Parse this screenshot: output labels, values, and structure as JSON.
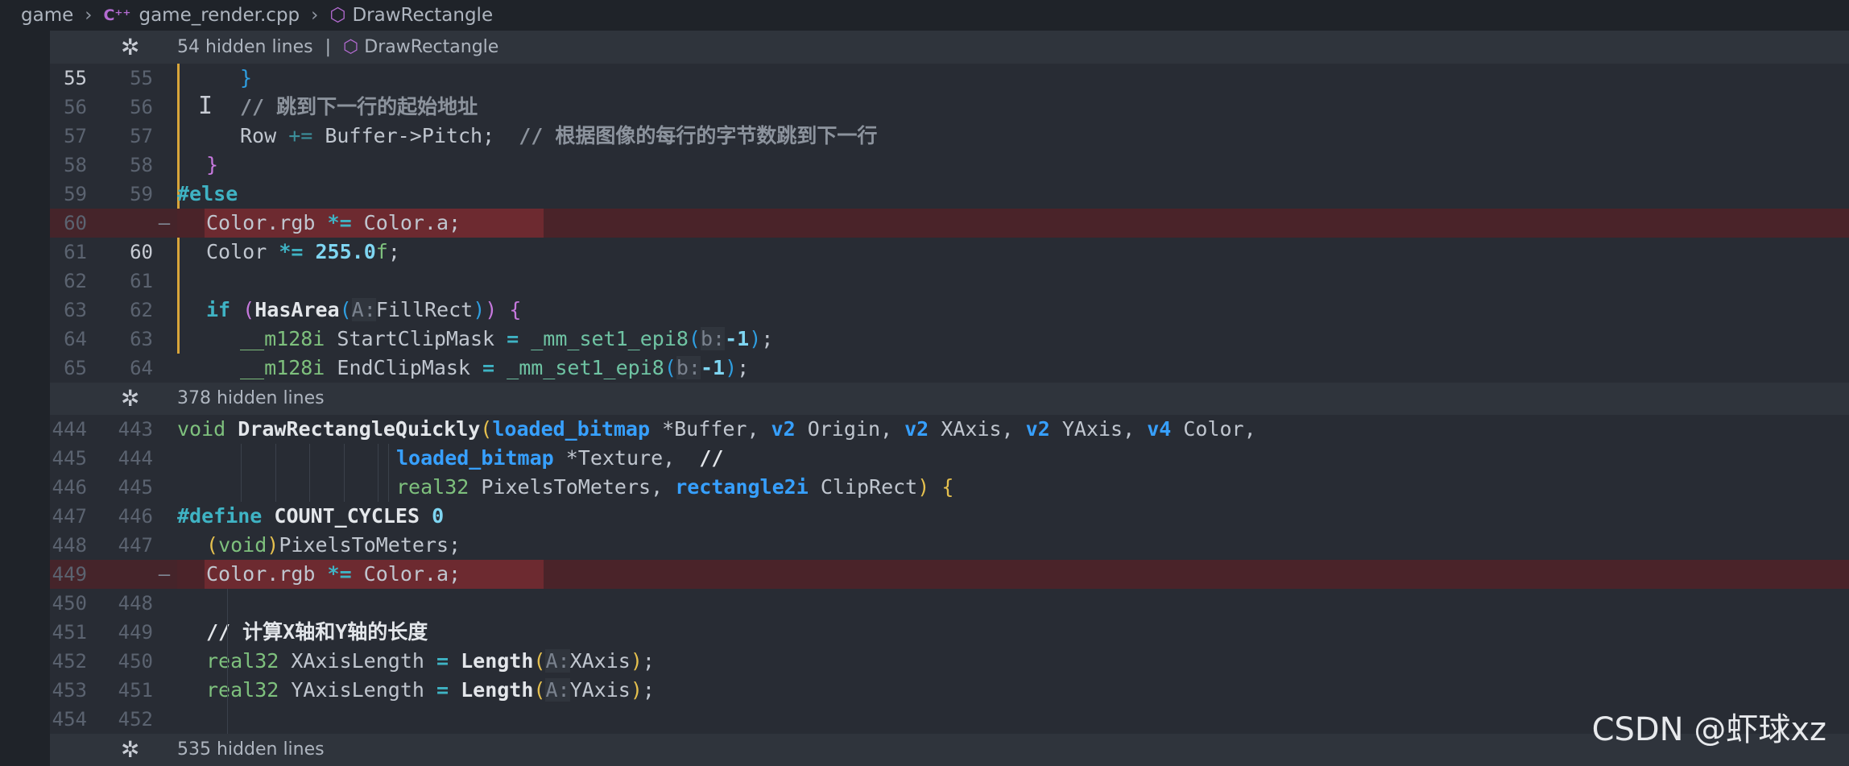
{
  "breadcrumb": {
    "folder": "game",
    "file": "game_render.cpp",
    "symbol": "DrawRectangle"
  },
  "hidden_bars": [
    {
      "text": "54 hidden lines",
      "symbol": "DrawRectangle"
    },
    {
      "text": "378 hidden lines"
    },
    {
      "text": "535 hidden lines"
    }
  ],
  "lines": {
    "l55": {
      "a": "55",
      "b": "55",
      "code": "}"
    },
    "l56": {
      "a": "56",
      "b": "56",
      "code": "// 跳到下一行的起始地址"
    },
    "l57": {
      "a": "57",
      "b": "57",
      "code1": "Row ",
      "op": "+=",
      "code2": " Buffer->Pitch;  ",
      "comment": "// 根据图像的每行的字节数跳到下一行"
    },
    "l58": {
      "a": "58",
      "b": "58",
      "code": "}"
    },
    "l59": {
      "a": "59",
      "b": "59",
      "code": "#else"
    },
    "l60": {
      "a": "60",
      "minus": "—",
      "code1": "Color.rgb ",
      "op": "*=",
      "code2": " Color.a;"
    },
    "l61": {
      "a": "61",
      "b": "60",
      "code1": "Color ",
      "op": "*=",
      "num": "255.0",
      "suffix": "f",
      "semi": ";"
    },
    "l62": {
      "a": "62",
      "b": "61"
    },
    "l63": {
      "a": "63",
      "b": "62",
      "kw": "if",
      "p1": "(",
      "fn": "HasArea",
      "p2": "(",
      "hint": "A:",
      "arg": "FillRect",
      "p3": ")",
      "p4": ")",
      "brace": "{"
    },
    "l64": {
      "a": "64",
      "b": "63",
      "typ": "__m128i",
      "name": " StartClipMask ",
      "eq": "=",
      "fn": " _mm_set1_epi8",
      "p1": "(",
      "hint": "b:",
      "num": "-1",
      "p2": ")",
      "semi": ";"
    },
    "l65": {
      "a": "65",
      "b": "64",
      "typ": "__m128i",
      "name": " EndClipMask ",
      "eq": "=",
      "fn": " _mm_set1_epi8",
      "p1": "(",
      "hint": "b:",
      "num": "-1",
      "p2": ")",
      "semi": ";"
    },
    "l444": {
      "a": "444",
      "b": "443",
      "void": "void ",
      "fn": "DrawRectangleQuickly",
      "p1": "(",
      "t1": "loaded_bitmap",
      "a1": " *Buffer, ",
      "t2": "v2",
      "a2": " Origin, ",
      "t3": "v2",
      "a3": " XAxis, ",
      "t4": "v2",
      "a4": " YAxis, ",
      "t5": "v4",
      "a5": " Color,"
    },
    "l445": {
      "a": "445",
      "b": "444",
      "t1": "loaded_bitmap",
      "a1": " *Texture,  ",
      "com": "//"
    },
    "l446": {
      "a": "446",
      "b": "445",
      "t1": "real32",
      "a1": " PixelsToMeters, ",
      "t2": "rectangle2i",
      "a2": " ClipRect",
      "p": ")",
      "brace": " {"
    },
    "l447": {
      "a": "447",
      "b": "446",
      "pp": "#define",
      "name": " COUNT_CYCLES",
      "num": " 0"
    },
    "l448": {
      "a": "448",
      "b": "447",
      "p1": "(",
      "kw": "void",
      "p2": ")",
      "rest": "PixelsToMeters;"
    },
    "l449": {
      "a": "449",
      "minus": "—",
      "code1": "Color.rgb ",
      "op": "*=",
      "code2": " Color.a;"
    },
    "l450": {
      "a": "450",
      "b": "448"
    },
    "l451": {
      "a": "451",
      "b": "449",
      "comment": "// 计算X轴和Y轴的长度"
    },
    "l452": {
      "a": "452",
      "b": "450",
      "typ": "real32",
      "name": " XAxisLength ",
      "eq": "=",
      "fn": " Length",
      "p1": "(",
      "hint": "A:",
      "arg": "XAxis",
      "p2": ")",
      "semi": ";"
    },
    "l453": {
      "a": "453",
      "b": "451",
      "typ": "real32",
      "name": " YAxisLength ",
      "eq": "=",
      "fn": " Length",
      "p1": "(",
      "hint": "A:",
      "arg": "YAxis",
      "p2": ")",
      "semi": ";"
    },
    "l454": {
      "a": "454",
      "b": "452"
    }
  },
  "watermark": "CSDN @虾球xz",
  "colors": {
    "background": "#282c34",
    "deleted_line": "#4a2329",
    "change_bar": "#d8a53a",
    "keyword": "#3fb3c4",
    "type": "#37a0ff",
    "comment": "#8c939d"
  }
}
